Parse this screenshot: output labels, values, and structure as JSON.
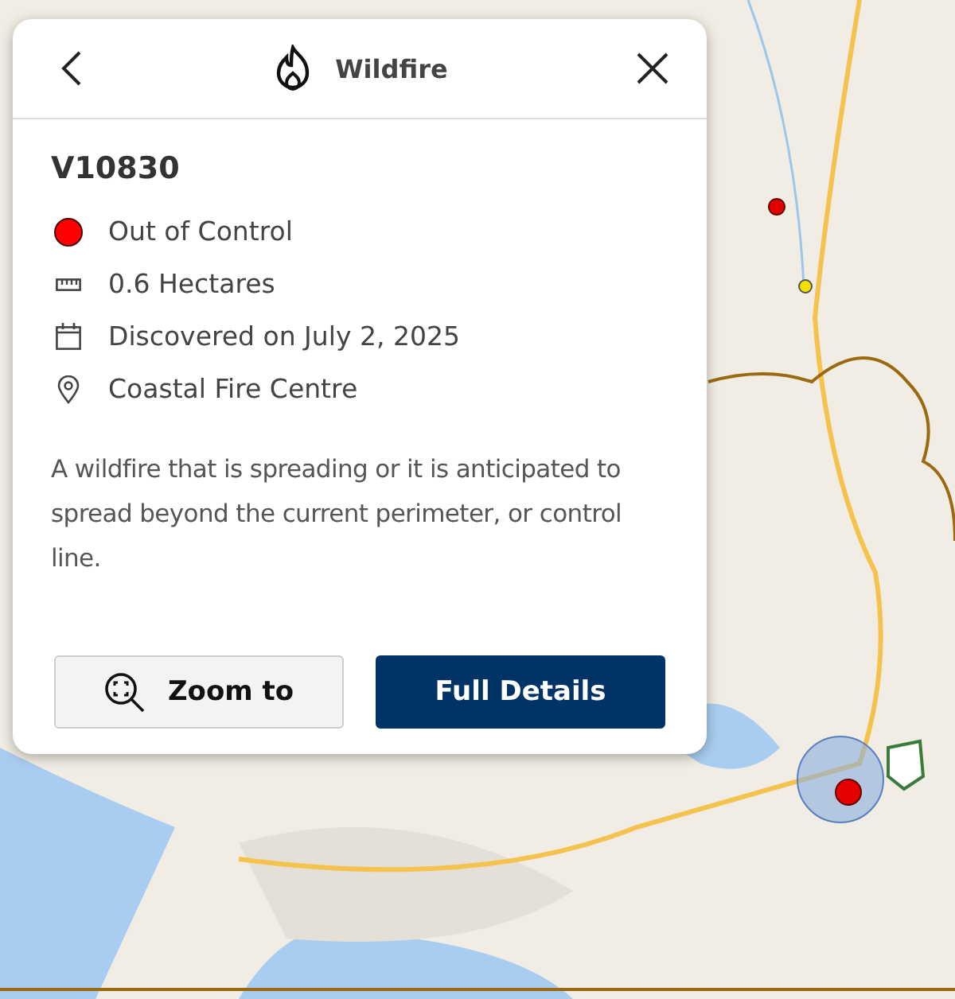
{
  "header": {
    "title": "Wildfire"
  },
  "fire": {
    "id": "V10830",
    "details": [
      {
        "kind": "status",
        "text": "Out of Control",
        "color": "#ff0000"
      },
      {
        "kind": "area",
        "text": "0.6 Hectares"
      },
      {
        "kind": "date",
        "text": "Discovered on July 2, 2025"
      },
      {
        "kind": "location",
        "text": "Coastal Fire Centre"
      }
    ],
    "description": "A wildfire that is spreading or it is anticipated to spread beyond the current perimeter, or control line."
  },
  "buttons": [
    {
      "kind": "zoom",
      "label": "Zoom to"
    },
    {
      "kind": "details",
      "label": "Full Details"
    }
  ]
}
